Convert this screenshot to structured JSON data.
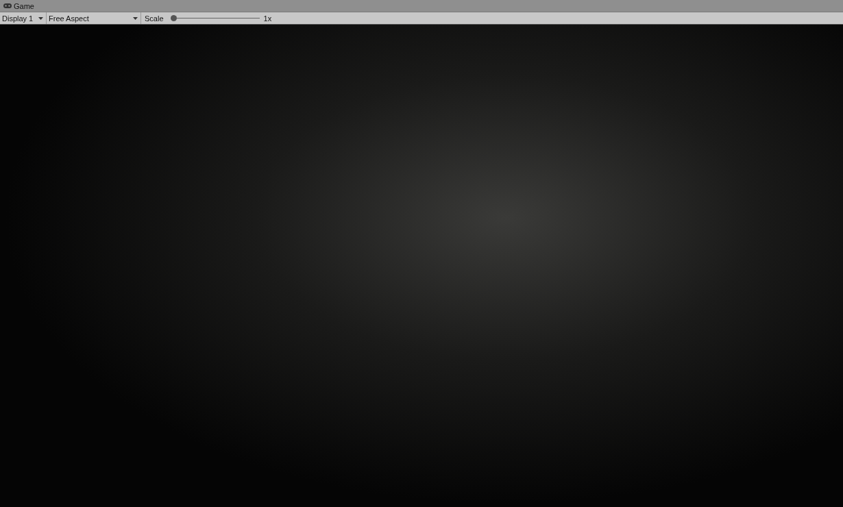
{
  "window": {
    "title": "Game"
  },
  "toolbar": {
    "display": "Display 1",
    "aspect": "Free Aspect",
    "scale": {
      "label": "Scale",
      "level": 0,
      "reading": "1x"
    }
  }
}
